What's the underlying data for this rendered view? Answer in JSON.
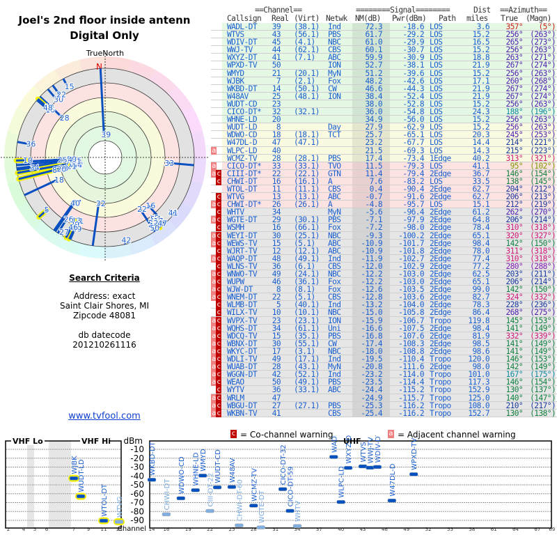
{
  "title": "Joel's 2nd floor inside antenn",
  "subtitle": "Digital Only",
  "polar": {
    "north_label": "TrueNorth",
    "n_marker": "N"
  },
  "criteria": {
    "heading": "Search Criteria",
    "address": "Address: exact",
    "city": "Saint Clair Shores, MI",
    "zip": "Zipcode 48081",
    "db_label": "db datecode",
    "db_code": "201210261116"
  },
  "site_link": "www.tvfool.com",
  "table": {
    "group_headers": {
      "channel": "==Channel==",
      "signal": "========Signal========",
      "dist": "Dist",
      "azimuth": "==Azimuth=="
    },
    "columns": [
      "Callsign",
      "Real",
      "(Virt)",
      "Netwk",
      "NM(dB)",
      "Pwr(dBm)",
      "Path",
      "miles",
      "True",
      "(Magn)"
    ],
    "rows": [
      [
        "",
        "WADL-DT",
        "39",
        "(38.1)",
        "Ind",
        "72.3",
        "-18.6",
        "LOS",
        "3.6",
        "357°",
        "(5°)"
      ],
      [
        "",
        "WTVS",
        "43",
        "(56.1)",
        "PBS",
        "61.7",
        "-29.2",
        "LOS",
        "15.2",
        "256°",
        "(263°)"
      ],
      [
        "",
        "WDIV-DT",
        "45",
        "(4.1)",
        "NBC",
        "61.0",
        "-29.9",
        "LOS",
        "16.5",
        "265°",
        "(273°)"
      ],
      [
        "",
        "WWJ-TV",
        "44",
        "(62.1)",
        "CBS",
        "60.1",
        "-30.7",
        "LOS",
        "15.2",
        "256°",
        "(263°)"
      ],
      [
        "",
        "WXYZ-DT",
        "41",
        "(7.1)",
        "ABC",
        "59.9",
        "-30.9",
        "LOS",
        "18.8",
        "263°",
        "(271°)"
      ],
      [
        "",
        "WPXD-TV",
        "50",
        "",
        "ION",
        "52.7",
        "-38.1",
        "LOS",
        "21.9",
        "267°",
        "(274°)"
      ],
      [
        "",
        "WMYD",
        "21",
        "(20.1)",
        "MyN",
        "51.2",
        "-39.6",
        "LOS",
        "15.2",
        "256°",
        "(263°)"
      ],
      [
        "",
        "WJBK",
        "7",
        "(2.1)",
        "Fox",
        "48.2",
        "-42.6",
        "LOS",
        "17.1",
        "260°",
        "(268°)"
      ],
      [
        "",
        "WKBD-DT",
        "14",
        "(50.1)",
        "CW",
        "46.6",
        "-44.3",
        "LOS",
        "21.9",
        "267°",
        "(274°)"
      ],
      [
        "",
        "W48AV",
        "25",
        "(48.1)",
        "ION",
        "38.4",
        "-52.4",
        "LOS",
        "21.9",
        "267°",
        "(274°)"
      ],
      [
        "",
        "WUDT-CD",
        "23",
        "",
        "",
        "38.0",
        "-52.8",
        "LOS",
        "15.2",
        "256°",
        "(263°)"
      ],
      [
        "",
        "CICO-DT*",
        "32",
        "(32.1)",
        "",
        "36.0",
        "-54.8",
        "LOS",
        "24.3",
        "188°",
        "(196°)"
      ],
      [
        "",
        "WHNE-LD",
        "20",
        "",
        "",
        "34.9",
        "-56.0",
        "LOS",
        "15.2",
        "256°",
        "(263°)"
      ],
      [
        "",
        "WUDT-LD",
        "8",
        "",
        "Day",
        "27.9",
        "-62.9",
        "LOS",
        "15.2",
        "256°",
        "(263°)"
      ],
      [
        "",
        "WDWO-CD",
        "18",
        "(18.1)",
        "TCT",
        "25.7",
        "-65.1",
        "LOS",
        "20.3",
        "245°",
        "(253°)"
      ],
      [
        "",
        "W47DL-D",
        "47",
        "(47.1)",
        "",
        "23.2",
        "-67.7",
        "LOS",
        "14.4",
        "214°",
        "(221°)"
      ],
      [
        "a",
        "WLPC-LD",
        "40",
        "",
        "",
        "21.5",
        "-69.3",
        "LOS",
        "14.3",
        "215°",
        "(223°)"
      ],
      [
        "",
        "WCMZ-TV",
        "28",
        "(28.1)",
        "PBS",
        "17.4",
        "-73.4",
        "1Edge",
        "40.2",
        "313°",
        "(321°)"
      ],
      [
        "a",
        "CICO-DT*",
        "33",
        "(33.1)",
        "TVO",
        "11.5",
        "-79.3",
        "LOS",
        "41.1",
        "95°",
        "(102°)"
      ],
      [
        "ac",
        "CIII-DT*",
        "22",
        "(22.1)",
        "GTN",
        "11.4",
        "-79.4",
        "2Edge",
        "36.7",
        "146°",
        "(154°)"
      ],
      [
        "c",
        "CHWI-DT",
        "16",
        "(16.1)",
        "A",
        "7.6",
        "-83.2",
        "LOS",
        "33.5",
        "138°",
        "(145°)"
      ],
      [
        "",
        "WTOL-DT",
        "11",
        "(11.1)",
        "CBS",
        "0.4",
        "-90.4",
        "2Edge",
        "62.7",
        "204°",
        "(212°)"
      ],
      [
        "c",
        "WTVG",
        "13",
        "(13.1)",
        "ABC",
        "-0.7",
        "-91.6",
        "2Edge",
        "62.7",
        "206°",
        "(213°)"
      ],
      [
        "ac",
        "CHWI-DT*",
        "26",
        "(26.1)",
        "A",
        "-4.8",
        "-95.7",
        "LOS",
        "15.1",
        "212°",
        "(219°)"
      ],
      [
        "c",
        "WHTV",
        "34",
        "",
        "MyN",
        "-5.6",
        "-96.4",
        "2Edge",
        "61.2",
        "262°",
        "(270°)"
      ],
      [
        "ac",
        "WGTE-DT",
        "29",
        "(30.1)",
        "PBS",
        "-7.1",
        "-97.9",
        "2Edge",
        "64.8",
        "206°",
        "(214°)"
      ],
      [
        "c",
        "WSMH",
        "16",
        "(66.1)",
        "Fox",
        "-7.2",
        "-98.0",
        "2Edge",
        "78.4",
        "310°",
        "(318°)"
      ],
      [
        "ac",
        "WEYI-DT",
        "30",
        "(25.1)",
        "NBC",
        "-9.3",
        "-100.2",
        "2Edge",
        "65.1",
        "320°",
        "(327°)"
      ],
      [
        "ac",
        "WEWS-TV",
        "15",
        "(5.1)",
        "ABC",
        "-10.9",
        "-101.7",
        "2Edge",
        "98.4",
        "142°",
        "(150°)"
      ],
      [
        "c",
        "WJRT-TV",
        "12",
        "(12.1)",
        "ABC",
        "-10.9",
        "-101.8",
        "2Edge",
        "78.0",
        "311°",
        "(318°)"
      ],
      [
        "ac",
        "WAQP-DT",
        "48",
        "(49.1)",
        "Ind",
        "-11.9",
        "-102.7",
        "2Edge",
        "77.4",
        "310°",
        "(318°)"
      ],
      [
        "c",
        "WLNS-TV",
        "36",
        "(6.1)",
        "CBS",
        "-12.0",
        "-102.9",
        "2Edge",
        "77.2",
        "280°",
        "(288°)"
      ],
      [
        "ac",
        "WNWO-TV",
        "49",
        "(24.1)",
        "NBC",
        "-12.2",
        "-103.0",
        "2Edge",
        "62.5",
        "203°",
        "(211°)"
      ],
      [
        "ac",
        "WUPW",
        "46",
        "(36.1)",
        "Fox",
        "-12.2",
        "-103.0",
        "2Edge",
        "65.1",
        "206°",
        "(214°)"
      ],
      [
        "ac",
        "WJW-DT",
        "8",
        "(8.1)",
        "Fox",
        "-12.6",
        "-103.5",
        "2Edge",
        "99.0",
        "142°",
        "(150°)"
      ],
      [
        "ac",
        "WNEM-DT",
        "22",
        "(5.1)",
        "CBS",
        "-12.8",
        "-103.6",
        "2Edge",
        "82.7",
        "324°",
        "(332°)"
      ],
      [
        "c",
        "WLMB-DT",
        "5",
        "(40.1)",
        "Ind",
        "-13.2",
        "-104.0",
        "2Edge",
        "78.3",
        "228°",
        "(236°)"
      ],
      [
        "c",
        "WILX-TV",
        "10",
        "(10.1)",
        "NBC",
        "-15.0",
        "-105.8",
        "2Edge",
        "86.4",
        "268°",
        "(275°)"
      ],
      [
        "ac",
        "WVPX-TV",
        "23",
        "(23.1)",
        "ION",
        "-15.9",
        "-106.7",
        "Tropo",
        "119.8",
        "145°",
        "(153°)"
      ],
      [
        "ac",
        "WQHS-DT",
        "34",
        "(61.1)",
        "Uni",
        "-16.6",
        "-107.5",
        "2Edge",
        "98.4",
        "141°",
        "(149°)"
      ],
      [
        "ac",
        "WDCQ-TV",
        "15",
        "(35.1)",
        "PBS",
        "-16.8",
        "-107.6",
        "2Edge",
        "81.9",
        "332°",
        "(339°)"
      ],
      [
        "ac",
        "WBNX-DT",
        "30",
        "(55.1)",
        "CW",
        "-17.4",
        "-108.3",
        "2Edge",
        "98.5",
        "141°",
        "(149°)"
      ],
      [
        "ac",
        "WKYC-DT",
        "17",
        "(3.1)",
        "NBC",
        "-18.0",
        "-108.8",
        "2Edge",
        "98.6",
        "141°",
        "(149°)"
      ],
      [
        "ac",
        "WDLI-TV",
        "49",
        "(17.1)",
        "Ind",
        "-19.5",
        "-110.4",
        "Tropo",
        "120.0",
        "146°",
        "(153°)"
      ],
      [
        "ac",
        "WUAB-DT",
        "28",
        "(43.1)",
        "MyN",
        "-20.8",
        "-111.6",
        "2Edge",
        "98.0",
        "142°",
        "(149°)"
      ],
      [
        "ac",
        "WGGN-DT",
        "42",
        "(52.1)",
        "Ind",
        "-23.2",
        "-114.0",
        "Tropo",
        "101.0",
        "167°",
        "(175°)"
      ],
      [
        "ac",
        "WEAO",
        "50",
        "(49.1)",
        "PBS",
        "-23.5",
        "-114.4",
        "Tropo",
        "117.3",
        "146°",
        "(154°)"
      ],
      [
        "c",
        "WYTV",
        "36",
        "(33.1)",
        "ABC",
        "-24.4",
        "-115.2",
        "Tropo",
        "152.9",
        "130°",
        "(137°)"
      ],
      [
        "ac",
        "WRLM",
        "47",
        "",
        "",
        "-24.9",
        "-115.7",
        "Tropo",
        "125.0",
        "140°",
        "(147°)"
      ],
      [
        "ac",
        "WBGU-DT",
        "27",
        "(27.1)",
        "PBS",
        "-25.3",
        "-116.2",
        "Tropo",
        "108.0",
        "210°",
        "(217°)"
      ],
      [
        "ac",
        "WKBN-TV",
        "41",
        "",
        "CBS",
        "-25.4",
        "-116.2",
        "Tropo",
        "152.7",
        "130°",
        "(138°)"
      ]
    ]
  },
  "legend": {
    "c_flag": "c",
    "c_text": "= Co-channel warning",
    "a_flag": "a",
    "a_text": "= Adjacent channel warning"
  },
  "spectrum": {
    "vhf_lo_label": "VHF Lo",
    "vhf_hi_label": "VHF Hi",
    "uhf_label": "UHF",
    "unit": "dBm",
    "channel_label": "Channel",
    "db_ticks": [
      "-10",
      "-20",
      "-30",
      "-40",
      "-50",
      "-60",
      "-70",
      "-80",
      "-90"
    ],
    "vhf_ticks": [
      "2",
      "4",
      "5",
      "6",
      "7",
      "9",
      "11",
      "13"
    ],
    "uhf_ticks": [
      "14",
      "16",
      "19",
      "22",
      "25",
      "28",
      "31",
      "34",
      "37",
      "40",
      "43",
      "46",
      "49",
      "52",
      "55",
      "58",
      "61",
      "64",
      "67",
      "69"
    ],
    "markers": [
      {
        "label": "WJBK",
        "ch": 7,
        "dbm": -42.6,
        "muted": false
      },
      {
        "label": "WUDT-LD",
        "ch": 8,
        "dbm": -62.9,
        "muted": false
      },
      {
        "label": "WTOL-DT",
        "ch": 11,
        "dbm": -90.4,
        "muted": false
      },
      {
        "label": "WTVG",
        "ch": 13,
        "dbm": -91.6,
        "muted": true
      },
      {
        "label": "WKBD-DT",
        "ch": 14,
        "dbm": -44.3,
        "muted": false
      },
      {
        "label": "CHWI-DT",
        "ch": 16,
        "dbm": -83.2,
        "muted": true
      },
      {
        "label": "WDWO-CD",
        "ch": 18,
        "dbm": -65.1,
        "muted": false
      },
      {
        "label": "WHNE-LD",
        "ch": 20,
        "dbm": -56.0,
        "muted": false
      },
      {
        "label": "WMYD",
        "ch": 21,
        "dbm": -39.6,
        "muted": false
      },
      {
        "label": "CIII-DT-22",
        "ch": 22,
        "dbm": -79.4,
        "muted": true
      },
      {
        "label": "WUDT-CD",
        "ch": 23,
        "dbm": -52.8,
        "muted": false
      },
      {
        "label": "W48AV",
        "ch": 25,
        "dbm": -52.4,
        "muted": false
      },
      {
        "label": "CHWI-DT-60",
        "ch": 26,
        "dbm": -95.7,
        "muted": true
      },
      {
        "label": "WCMZ-TV",
        "ch": 28,
        "dbm": -73.4,
        "muted": false
      },
      {
        "label": "WGTE-DT",
        "ch": 29,
        "dbm": -97.9,
        "muted": true
      },
      {
        "label": "CICO-DT-32",
        "ch": 32,
        "dbm": -54.8,
        "muted": false
      },
      {
        "label": "CICO-DT-59",
        "ch": 33,
        "dbm": -79.3,
        "muted": false
      },
      {
        "label": "WHTV",
        "ch": 34,
        "dbm": -96.4,
        "muted": true
      },
      {
        "label": "WADL-DT",
        "ch": 39,
        "dbm": -18.6,
        "muted": false
      },
      {
        "label": "WLPC-LD",
        "ch": 40,
        "dbm": -69.3,
        "muted": false
      },
      {
        "label": "WXYZ-DT",
        "ch": 41,
        "dbm": -30.9,
        "muted": false
      },
      {
        "label": "WTVS",
        "ch": 43,
        "dbm": -29.2,
        "muted": false
      },
      {
        "label": "WWJ-TV",
        "ch": 44,
        "dbm": -30.7,
        "muted": false
      },
      {
        "label": "WDIV-DT",
        "ch": 45,
        "dbm": -29.9,
        "muted": false
      },
      {
        "label": "W47DL-D",
        "ch": 47,
        "dbm": -67.7,
        "muted": false
      },
      {
        "label": "WPXD-TV",
        "ch": 50,
        "dbm": -38.1,
        "muted": false
      }
    ]
  },
  "colors": {
    "text_blue": "#1a5fd0",
    "marker_blue": "#0050c0",
    "marker_muted": "#80aee0",
    "vhf_highlight": "#f0f000",
    "co_channel": "#c00000",
    "adjacent": "#f08080",
    "row_green": "#e4f8e4",
    "row_yellow": "#fafae0",
    "row_pink": "#fde2e2",
    "row_gray": "#e6e6e6"
  }
}
